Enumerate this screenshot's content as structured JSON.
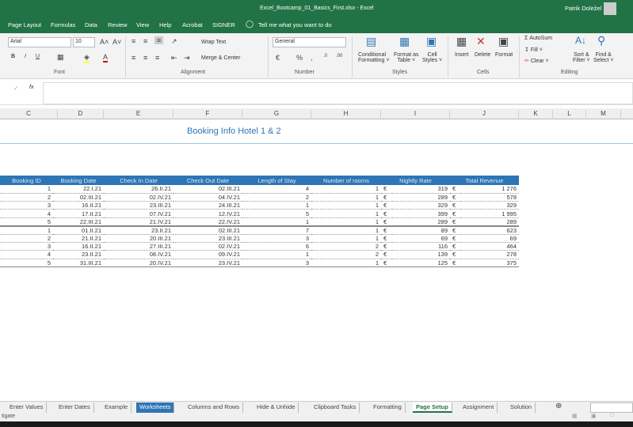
{
  "window": {
    "title": "Excel_Bootcamp_01_Basics_First.xlsx  -  Excel",
    "user": "Patrik Doležel"
  },
  "ribbon_tabs": [
    "Page Layout",
    "Formulas",
    "Data",
    "Review",
    "View",
    "Help",
    "Acrobat",
    "SIGNER"
  ],
  "tell_me": "Tell me what you want to do",
  "font": {
    "name": "Arial",
    "size": "10",
    "group": "Font"
  },
  "alignment": {
    "wrap": "Wrap Text",
    "merge": "Merge & Center",
    "group": "Alignment"
  },
  "number": {
    "format": "General",
    "group": "Number"
  },
  "styles": {
    "conditional": [
      "Conditional",
      "Formatting ˅"
    ],
    "format_table": [
      "Format as",
      "Table ˅"
    ],
    "cell_styles": [
      "Cell",
      "Styles ˅"
    ],
    "group": "Styles"
  },
  "cells": {
    "insert": "Insert",
    "delete": "Delete",
    "format": "Format",
    "group": "Cells"
  },
  "editing": {
    "autosum": "AutoSum",
    "fill": "Fill ˅",
    "clear": "Clear ˅",
    "sort": [
      "Sort &",
      "Filter ˅"
    ],
    "find": [
      "Find &",
      "Select ˅"
    ],
    "group": "Editing"
  },
  "formula_bar": {
    "fx": "fx",
    "value": ""
  },
  "columns": [
    "C",
    "D",
    "E",
    "F",
    "G",
    "H",
    "I",
    "J",
    "K",
    "L",
    "M"
  ],
  "sheet_title": "Booking Info Hotel 1 & 2",
  "table": {
    "headers": [
      "Booking ID",
      "Booking Date",
      "Check In Date",
      "Check Out Date",
      "Length of Stay",
      "Number of rooms",
      "Nightly Rate",
      "Total Revenue"
    ],
    "currency": "€",
    "rows": [
      [
        "1",
        "22.I.21",
        "26.II.21",
        "02.III.21",
        "4",
        "1",
        "319",
        "1 276"
      ],
      [
        "2",
        "02.III.21",
        "02.IV.21",
        "04.IV.21",
        "2",
        "1",
        "289",
        "578"
      ],
      [
        "3",
        "16.II.21",
        "23.III.21",
        "24.III.21",
        "1",
        "1",
        "329",
        "329"
      ],
      [
        "4",
        "17.II.21",
        "07.IV.21",
        "12.IV.21",
        "5",
        "1",
        "399",
        "1 995"
      ],
      [
        "5",
        "22.III.21",
        "21.IV.21",
        "22.IV.21",
        "1",
        "1",
        "289",
        "289"
      ],
      [
        "1",
        "01.II.21",
        "23.II.21",
        "02.III.21",
        "7",
        "1",
        "89",
        "623"
      ],
      [
        "2",
        "21.II.21",
        "20.III.21",
        "23.III.21",
        "3",
        "1",
        "69",
        "69"
      ],
      [
        "3",
        "16.II.21",
        "27.III.21",
        "02.IV.21",
        "6",
        "2",
        "116",
        "464"
      ],
      [
        "4",
        "23.II.21",
        "08.IV.21",
        "09.IV.21",
        "1",
        "2",
        "139",
        "278"
      ],
      [
        "5",
        "31.III.21",
        "20.IV.21",
        "23.IV.21",
        "3",
        "1",
        "125",
        "375"
      ]
    ]
  },
  "sheet_tabs": [
    "Enter Values",
    "Enter Dates",
    "Example",
    "Worksheets",
    "Columns and Rows",
    "Hide & Unhide",
    "Clipboard Tasks",
    "Formatting",
    "Page Setup",
    "Assignment",
    "Solution"
  ],
  "selected_tab": "Worksheets",
  "active_tab": "Page Setup",
  "status": "tigate",
  "colors": {
    "excel_green": "#217346",
    "header_blue": "#2e75b6"
  }
}
